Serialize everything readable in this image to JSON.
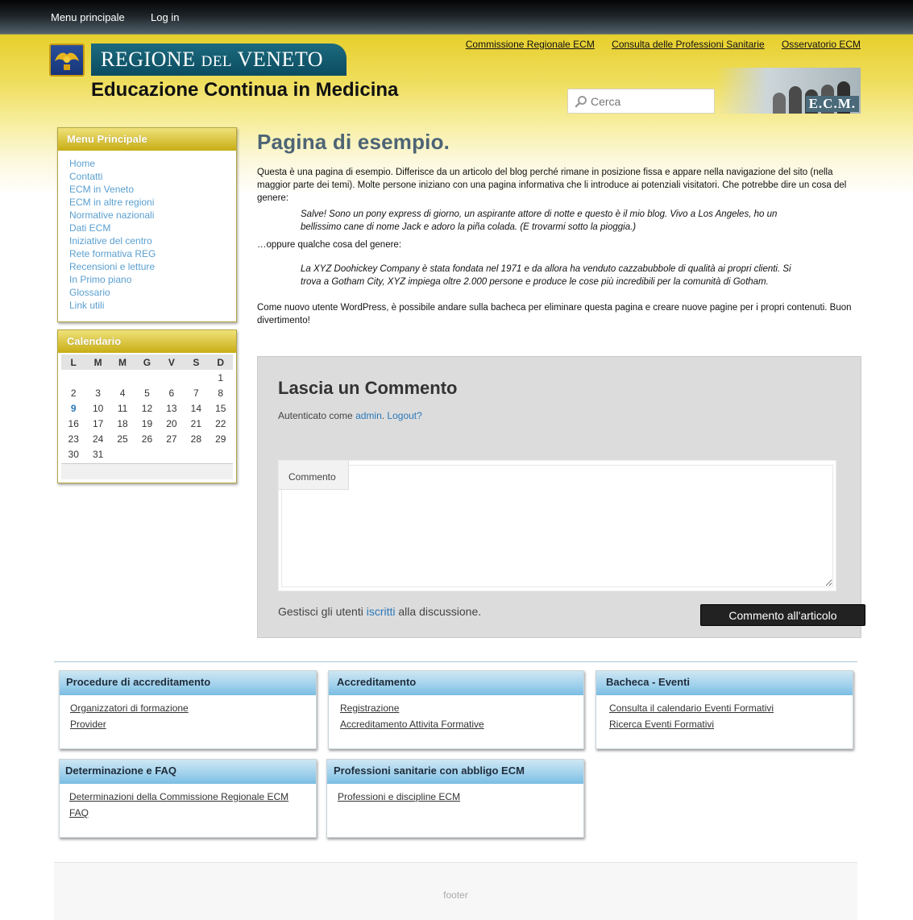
{
  "topbar": {
    "menu_link": "Menu principale",
    "login_link": "Log in"
  },
  "header": {
    "logo_main": "REGIONE",
    "logo_del": "DEL",
    "logo_region": "VENETO",
    "site_title": "Educazione Continua in Medicina",
    "top_links": [
      "Commissione Regionale ECM",
      "Consulta delle Professioni Sanitarie",
      "Osservatorio ECM"
    ],
    "search_placeholder": "Cerca",
    "ecm_label": "E.C.M."
  },
  "sidebar": {
    "menu_title": "Menu Principale",
    "menu_items": [
      "Home",
      "Contatti",
      "ECM in Veneto",
      "ECM in altre regioni",
      "Normative nazionali",
      "Dati ECM",
      "Iniziative del centro",
      "Rete formativa REG",
      "Recensioni e letture",
      "In Primo piano",
      "Glossario",
      "Link utili"
    ],
    "calendar_title": "Calendario",
    "calendar_days": [
      "L",
      "M",
      "M",
      "G",
      "V",
      "S",
      "D"
    ],
    "calendar_weeks": [
      [
        "",
        "",
        "",
        "",
        "",
        "",
        "1"
      ],
      [
        "2",
        "3",
        "4",
        "5",
        "6",
        "7",
        "8"
      ],
      [
        "9",
        "10",
        "11",
        "12",
        "13",
        "14",
        "15"
      ],
      [
        "16",
        "17",
        "18",
        "19",
        "20",
        "21",
        "22"
      ],
      [
        "23",
        "24",
        "25",
        "26",
        "27",
        "28",
        "29"
      ],
      [
        "30",
        "31",
        "",
        "",
        "",
        "",
        ""
      ]
    ],
    "calendar_today": "9"
  },
  "content": {
    "title": "Pagina di esempio.",
    "intro": "Questa è una pagina di esempio. Differisce da un articolo del blog perché rimane in posizione fissa e appare nella navigazione del sito (nella maggior parte dei temi). Molte persone iniziano con una pagina informativa che li introduce ai potenziali visitatori. Che potrebbe dire un cosa del genere:",
    "quote1": "Salve! Sono un pony express di giorno, un aspirante attore di notte e questo è il mio blog. Vivo a Los Angeles, ho un bellissimo cane di nome Jack e adoro la piña colada. (E trovarmi sotto la pioggia.)",
    "middle": "…oppure qualche cosa del genere:",
    "quote2": "La XYZ Doohickey Company è stata fondata nel 1971 e da allora ha venduto cazzabubbole di qualità ai propri clienti. Si trova a Gotham City, XYZ impiega oltre 2.000 persone e produce le cose più incredibili per la comunità di Gotham.",
    "outro": "Come nuovo utente WordPress, è possibile andare sulla bacheca per eliminare questa pagina e creare nuove pagine per i propri contenuti. Buon divertimento!"
  },
  "comments": {
    "heading": "Lascia un Commento",
    "logged_prefix": "Autenticato come ",
    "logged_user": "admin",
    "logged_sep": ". ",
    "logout": "Logout?",
    "comment_label": "Commento",
    "manage_prefix": "Gestisci gli utenti ",
    "manage_link": "iscritti",
    "manage_suffix": " alla discussione.",
    "submit": "Commento all'articolo"
  },
  "footer_boxes": [
    {
      "title": "Procedure di accreditamento",
      "links": [
        "Organizzatori di formazione",
        "Provider"
      ]
    },
    {
      "title": "Accreditamento",
      "links": [
        "Registrazione",
        "Accreditamento Attivita Formative"
      ]
    },
    {
      "title": "Bacheca - Eventi",
      "links": [
        "Consulta il calendario Eventi Formativi",
        "Ricerca Eventi Formativi"
      ]
    },
    {
      "title": "Determinazione e FAQ",
      "links": [
        "Determinazioni della Commissione Regionale ECM",
        "FAQ"
      ]
    },
    {
      "title": "Professioni sanitarie con abbligo ECM",
      "links": [
        "Professioni e discipline ECM"
      ]
    }
  ],
  "footer_text": "footer"
}
